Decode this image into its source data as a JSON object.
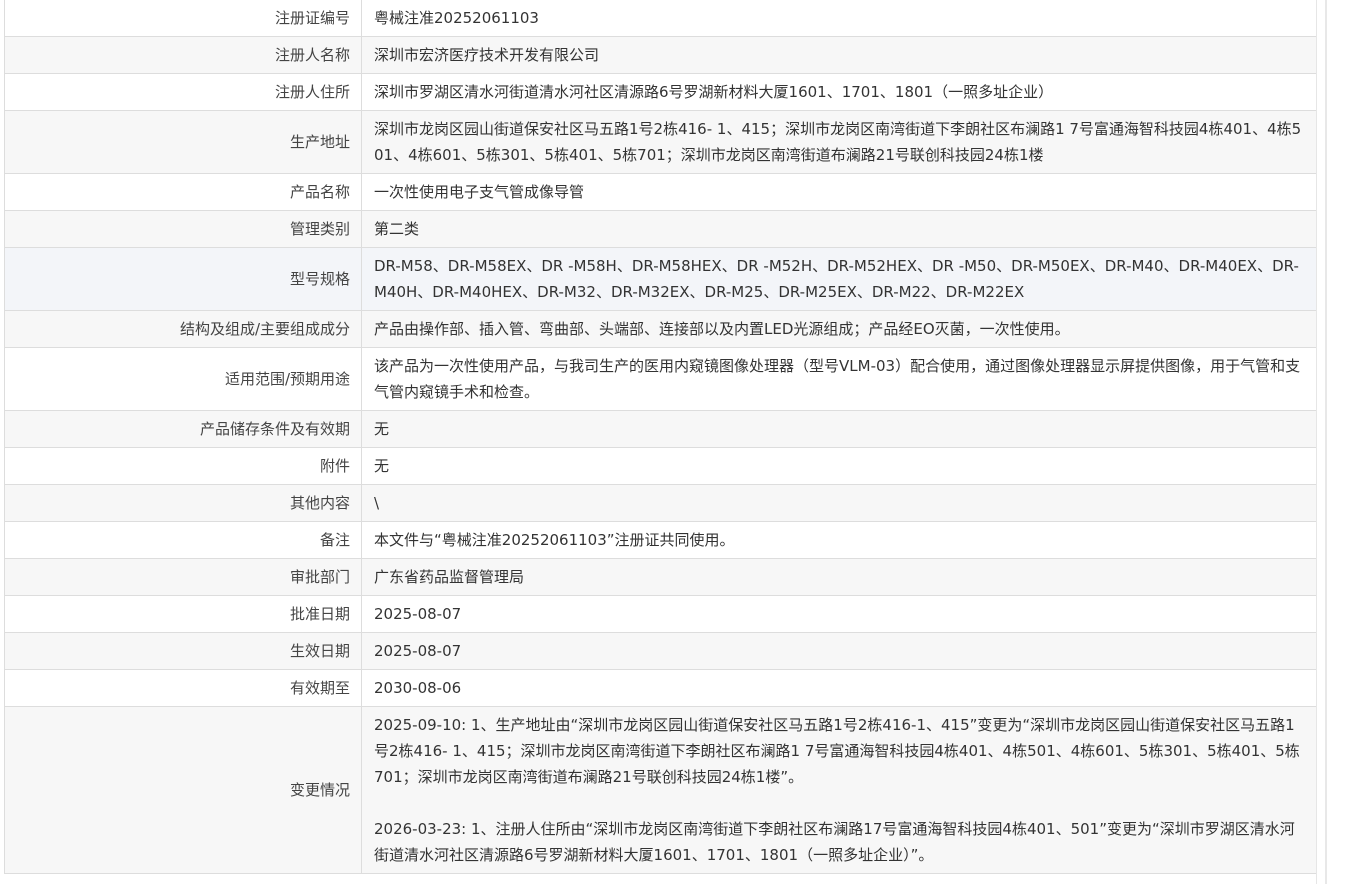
{
  "rows": [
    {
      "label": "注册证编号",
      "value": "粤械注准20252061103"
    },
    {
      "label": "注册人名称",
      "value": "深圳市宏济医疗技术开发有限公司"
    },
    {
      "label": "注册人住所",
      "value": "深圳市罗湖区清水河街道清水河社区清源路6号罗湖新材料大厦1601、1701、1801（一照多址企业）"
    },
    {
      "label": "生产地址",
      "value": "深圳市龙岗区园山街道保安社区马五路1号2栋416- 1、415；深圳市龙岗区南湾街道下李朗社区布澜路1 7号富通海智科技园4栋401、4栋501、4栋601、5栋301、5栋401、5栋701；深圳市龙岗区南湾街道布澜路21号联创科技园24栋1楼"
    },
    {
      "label": "产品名称",
      "value": "一次性使用电子支气管成像导管"
    },
    {
      "label": "管理类别",
      "value": "第二类"
    },
    {
      "label": "型号规格",
      "value": "DR-M58、DR-M58EX、DR -M58H、DR-M58HEX、DR -M52H、DR-M52HEX、DR -M50、DR-M50EX、DR-M40、DR-M40EX、DR-M40H、DR-M40HEX、DR-M32、DR-M32EX、DR-M25、DR-M25EX、DR-M22、DR-M22EX"
    },
    {
      "label": "结构及组成/主要组成成分",
      "value": "产品由操作部、插入管、弯曲部、头端部、连接部以及内置LED光源组成；产品经EO灭菌，一次性使用。"
    },
    {
      "label": "适用范围/预期用途",
      "value": "该产品为一次性使用产品，与我司生产的医用内窥镜图像处理器（型号VLM-03）配合使用，通过图像处理器显示屏提供图像，用于气管和支气管内窥镜手术和检查。"
    },
    {
      "label": "产品储存条件及有效期",
      "value": "无"
    },
    {
      "label": "附件",
      "value": "无"
    },
    {
      "label": "其他内容",
      "value": "\\"
    },
    {
      "label": "备注",
      "value": "本文件与“粤械注准20252061103”注册证共同使用。"
    },
    {
      "label": "审批部门",
      "value": "广东省药品监督管理局"
    },
    {
      "label": "批准日期",
      "value": "2025-08-07"
    },
    {
      "label": "生效日期",
      "value": "2025-08-07"
    },
    {
      "label": "有效期至",
      "value": "2030-08-06"
    }
  ],
  "changes": {
    "label": "变更情况",
    "entries": [
      "2025-09-10: 1、生产地址由“深圳市龙岗区园山街道保安社区马五路1号2栋416-1、415”变更为“深圳市龙岗区园山街道保安社区马五路1号2栋416- 1、415；深圳市龙岗区南湾街道下李朗社区布澜路1 7号富通海智科技园4栋401、4栋501、4栋601、5栋301、5栋401、5栋701；深圳市龙岗区南湾街道布澜路21号联创科技园24栋1楼”。",
      "2026-03-23: 1、注册人住所由“深圳市龙岗区南湾街道下李朗社区布澜路17号富通海智科技园4栋401、501”变更为“深圳市罗湖区清水河街道清水河社区清源路6号罗湖新材料大厦1601、1701、1801（一照多址企业）”。"
    ]
  }
}
